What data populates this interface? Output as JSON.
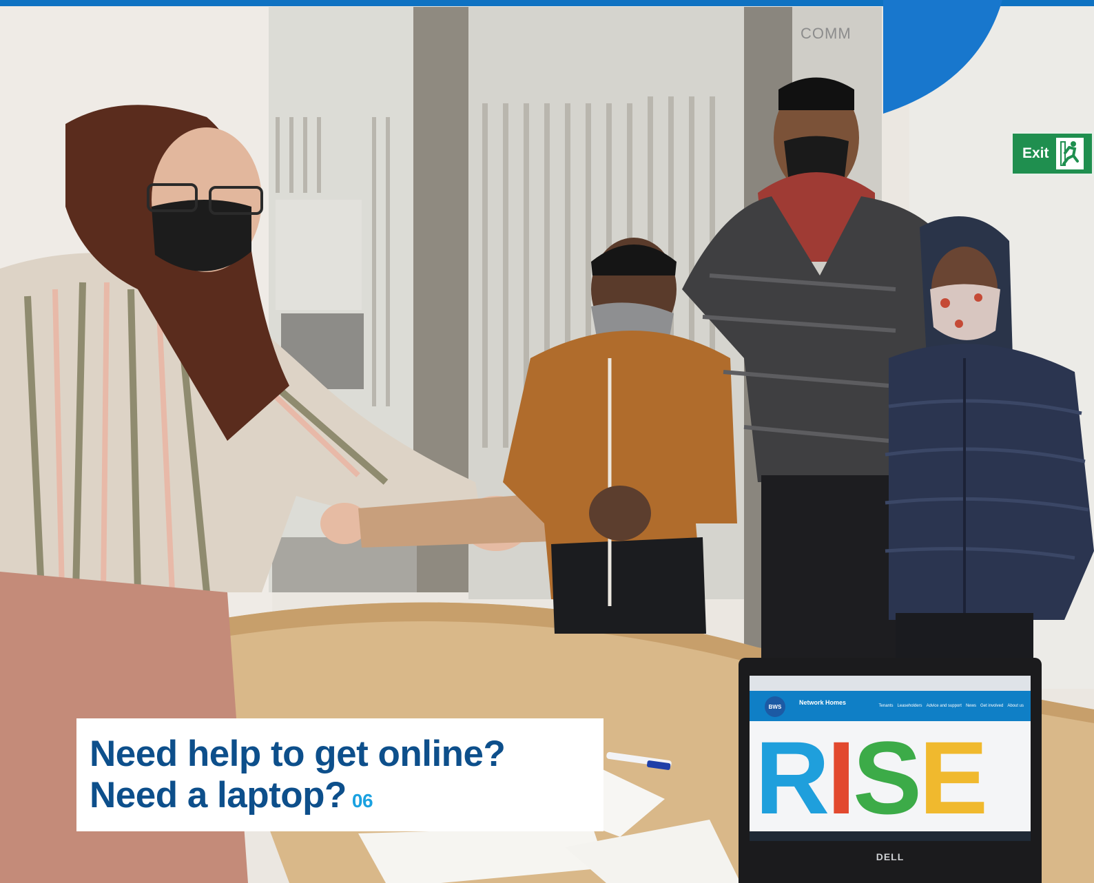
{
  "headline": {
    "line1": "Need help to get online?",
    "line2": "Need a laptop?",
    "page_number": "06"
  },
  "sign": {
    "text": "Exit",
    "icon": "running-man-icon"
  },
  "background_sign": {
    "text": "COMM"
  },
  "laptop": {
    "brand": "DELL",
    "site_logo": "BWS",
    "site_partner": "Network Homes",
    "nav": [
      "Tenants",
      "Leaseholders",
      "Advice and support",
      "News",
      "Get involved",
      "About us"
    ],
    "banner": [
      "R",
      "I",
      "S",
      "E"
    ]
  },
  "colors": {
    "headline": "#0d4f8b",
    "page_number": "#1aa1e0",
    "top_bar": "#0f72c2",
    "corner_accent": "#1877cd",
    "exit_sign": "#1f8f4f",
    "rise_r": "#1f9fdc",
    "rise_i": "#e2492f",
    "rise_s": "#3cab48",
    "rise_e": "#f0b92e"
  }
}
